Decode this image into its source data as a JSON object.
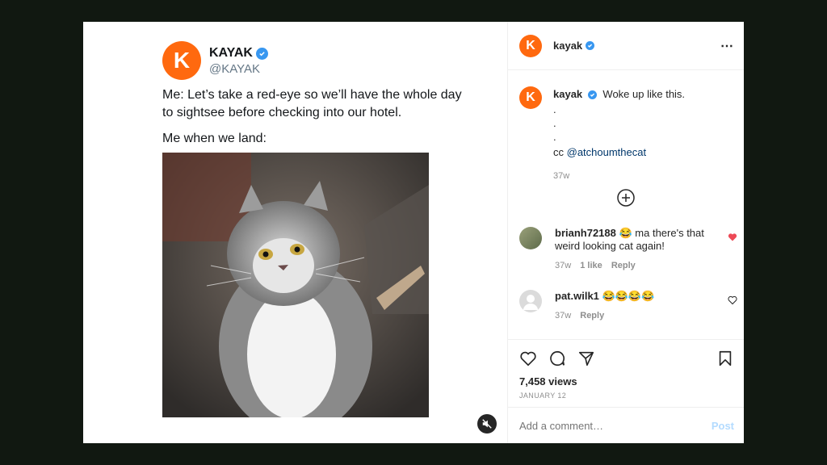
{
  "tweet": {
    "avatar_letter": "K",
    "name": "KAYAK",
    "handle": "@KAYAK",
    "text": "Me: Let’s take a red-eye so we’ll have the whole day to sightsee before checking into our hotel.",
    "text2": "Me when we land:"
  },
  "post": {
    "avatar_letter": "K",
    "username": "kayak",
    "caption": "Woke up like this.",
    "dots": [
      ".",
      ".",
      "."
    ],
    "cc_prefix": "cc",
    "cc_handle": "@atchoumthecat",
    "caption_time": "37w"
  },
  "comments": [
    {
      "username": "brianh72188",
      "text": "😂 ma there's that weird looking cat again!",
      "time": "37w",
      "likes": "1 like",
      "reply": "Reply",
      "liked": true
    },
    {
      "username": "pat.wilk1",
      "text": "😂😂😂😂",
      "time": "37w",
      "reply": "Reply",
      "liked": false
    }
  ],
  "views": "7,458 views",
  "date": "JANUARY 12",
  "add_comment_placeholder": "Add a comment…",
  "post_button": "Post",
  "colors": {
    "brand": "#ff690f",
    "verified": "#3897f0",
    "liked": "#ed4956",
    "link": "#00376b"
  }
}
